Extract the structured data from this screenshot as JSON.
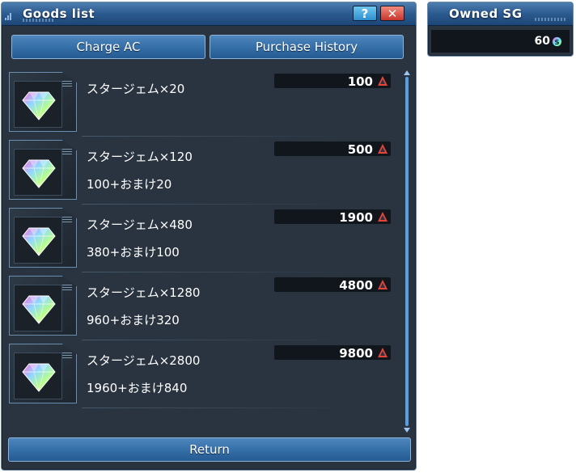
{
  "goods_window": {
    "title": "Goods list",
    "help_label": "?",
    "close_label": "✕",
    "charge_button": "Charge AC",
    "history_button": "Purchase History",
    "return_button": "Return"
  },
  "items": [
    {
      "name": "スタージェム×20",
      "bonus": "",
      "price": "100",
      "icon": "star-gem-icon"
    },
    {
      "name": "スタージェム×120",
      "bonus": "100+おまけ20",
      "price": "500",
      "icon": "star-gem-icon"
    },
    {
      "name": "スタージェム×480",
      "bonus": "380+おまけ100",
      "price": "1900",
      "icon": "star-gem-icon"
    },
    {
      "name": "スタージェム×1280",
      "bonus": "960+おまけ320",
      "price": "4800",
      "icon": "star-gem-icon"
    },
    {
      "name": "スタージェム×2800",
      "bonus": "1960+おまけ840",
      "price": "9800",
      "icon": "star-gem-icon"
    }
  ],
  "currency_icon": "ac-currency-icon",
  "owned_window": {
    "title": "Owned SG",
    "value": "60",
    "icon": "sg-currency-icon"
  },
  "colors": {
    "window_bg": "#2a3440",
    "titlebar": "#2d5d92",
    "button": "#3670a8",
    "price_bg": "#10161c",
    "ac_icon": "#e8453a"
  }
}
